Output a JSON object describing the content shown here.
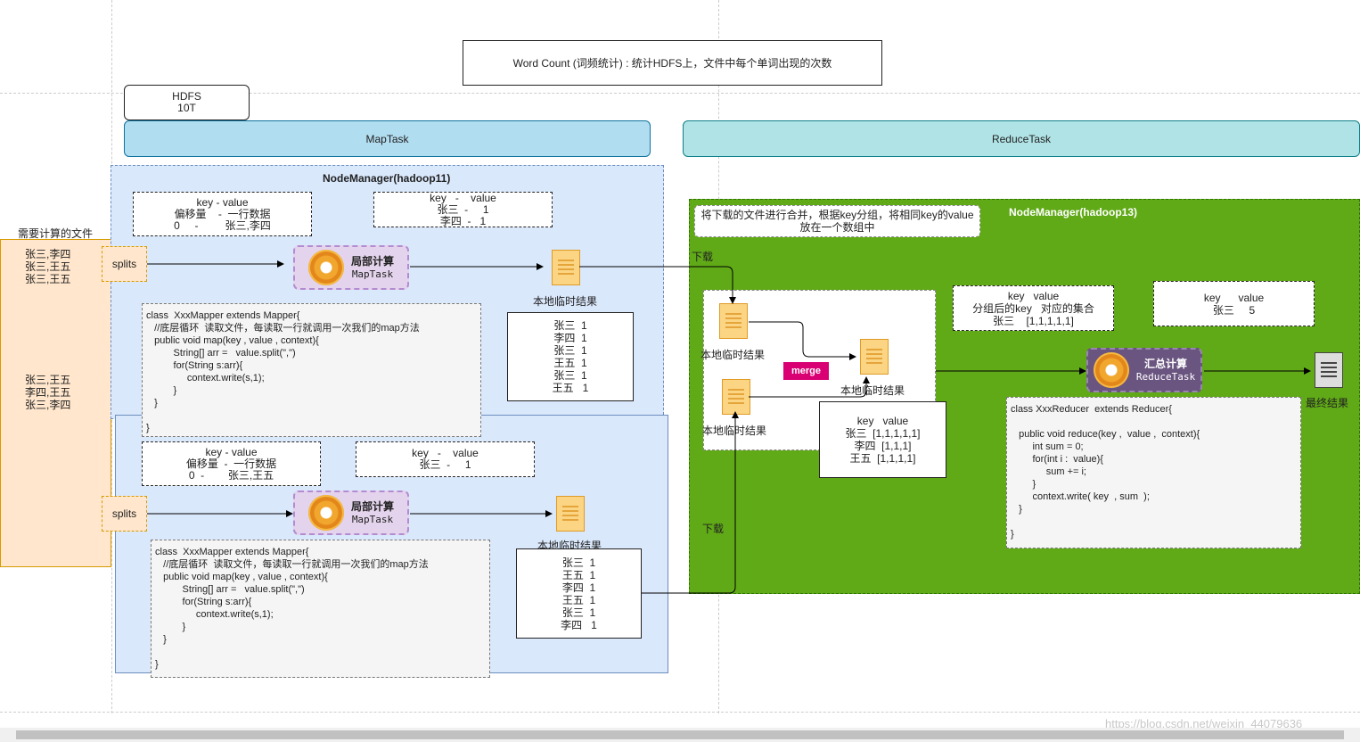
{
  "title": "Word Count (词频统计) : 统计HDFS上，文件中每个单词出现的次数",
  "hdfs": "HDFS\n10T",
  "map_header": "MapTask",
  "reduce_header": "ReduceTask",
  "input_label": "需要计算的文件",
  "input_lines_1": "张三,李四\n张三,王五\n张三,王五",
  "input_lines_2": "张三,王五\n李四,王五\n张三,李四",
  "splits": "splits",
  "nm_map": "NodeManager(hadoop11)",
  "nm_reduce": "NodeManager(hadoop13)",
  "map1": {
    "kv_in": "key - value\n偏移量    -  一行数据\n0     -         张三,李四",
    "kv_out": "key   -    value\n张三  -     1\n李四  -   1",
    "local_result": "本地临时结果",
    "result_list": "张三  1\n李四  1\n张三  1\n王五  1\n张三  1\n王五   1",
    "code": "class  XxxMapper extends Mapper{\n   //底层循环  读取文件，每读取一行就调用一次我们的map方法\n   public void map(key , value , context){\n          String[] arr =   value.split(\",\")\n          for(String s:arr){\n               context.write(s,1);\n          }\n   }\n\n}"
  },
  "map2": {
    "kv_in": "key - value\n偏移量  -  一行数据\n0  -        张三,王五",
    "kv_out": "key   -    value\n张三  -     1",
    "local_result": "本地临时结果",
    "result_list": "张三  1\n王五  1\n李四  1\n王五  1\n张三  1\n李四   1",
    "code": "class  XxxMapper extends Mapper{\n   //底层循环  读取文件，每读取一行就调用一次我们的map方法\n   public void map(key , value , context){\n          String[] arr =   value.split(\",\")\n          for(String s:arr){\n               context.write(s,1);\n          }\n   }\n\n}"
  },
  "task_local_title": "局部计算",
  "task_local_sub": "MapTask",
  "task_sum_title": "汇总计算",
  "task_sum_sub": "ReduceTask",
  "reduce": {
    "note": "将下载的文件进行合并，根据key分组，将相同key的value\n放在一个数组中",
    "download": "下载",
    "local_result": "本地临时结果",
    "merge": "merge",
    "grouped": "key   value\n张三  [1,1,1,1,1]\n李四  [1,1,1]\n王五  [1,1,1,1]",
    "group_desc": "key   value\n分组后的key   对应的集合\n张三    [1,1,1,1,1]",
    "final_kv": "key      value\n张三     5",
    "final_label": "最终结果",
    "code": "class XxxReducer  extends Reducer{\n\n   public void reduce(key ,  value ,  context){\n        int sum = 0;\n        for(int i :  value){\n             sum += i;\n        }\n        context.write( key  , sum  );\n   }\n\n}"
  },
  "watermark": "https://blog.csdn.net/weixin_44079636"
}
